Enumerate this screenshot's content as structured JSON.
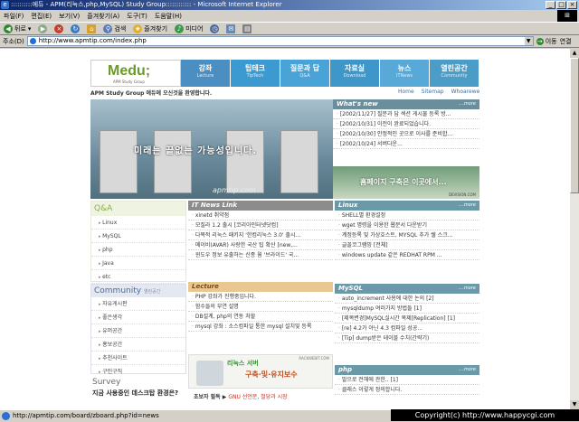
{
  "window": {
    "title": "::::::::::에듀 - APM(리눅스,php,MySQL) Study Group:::::::::::: - Microsoft Internet Explorer",
    "minimize": "_",
    "maximize": "□",
    "close": "×"
  },
  "menu": [
    "파일(F)",
    "편집(E)",
    "보기(V)",
    "즐겨찾기(A)",
    "도구(T)",
    "도움말(H)"
  ],
  "toolbar": {
    "back": "뒤로",
    "search": "검색",
    "favorites": "즐겨찾기",
    "media": "미디어"
  },
  "address": {
    "label": "주소(D)",
    "url": "http://www.apmtip.com/index.php",
    "go": "이동",
    "links": "연결"
  },
  "site": {
    "logo": "Medu;",
    "logo_sub": "APM Study Group",
    "nav": [
      {
        "ko": "강좌",
        "en": "Lecture",
        "color": "#4a8ec2"
      },
      {
        "ko": "팁테크",
        "en": "TipTech",
        "color": "#3d9ad0"
      },
      {
        "ko": "질문과 답",
        "en": "Q&A",
        "color": "#4aa3d6"
      },
      {
        "ko": "자료실",
        "en": "Download",
        "color": "#3e96c9"
      },
      {
        "ko": "뉴스",
        "en": "ITNews",
        "color": "#58a8d8"
      },
      {
        "ko": "열린공간",
        "en": "Community",
        "color": "#4b9cc6"
      }
    ],
    "welcome": "APM Study Group 에듀에 오신것을 환영합니다.",
    "top_links": [
      "Home",
      "Sitemap",
      "Whoarewe"
    ],
    "hero_slogan": "미래는 끝없는 가능성입니다.",
    "hero_watermark": "apmtip.com",
    "more": "....more",
    "whats_new": {
      "title": "What's new",
      "items": [
        "[2002/11/27] 질문과 답 섹션 게시물 등록 방...",
        "[2002/10/31] 이전이 완료되었습니다.",
        "[2002/10/30] 안정적인 곳으로 이사를 준비합...",
        "[2002/10/24] 서버다운..."
      ]
    },
    "banner": {
      "text": "홈페이지 구축은 이곳에서...",
      "site": "DEVISION.COM"
    },
    "qa": {
      "title": "Q&A",
      "items": [
        "Linux",
        "MySQL",
        "php",
        "Java",
        "etc"
      ]
    },
    "community": {
      "title": "Community",
      "sub": "열린공간",
      "items": [
        "자유게시판",
        "좋은생각",
        "유머공간",
        "홍보공간",
        "추천사이트",
        "구인구직"
      ]
    },
    "survey": {
      "title": "Survey",
      "question": "지금 사용중인 데스크탑 환경은?"
    },
    "itnews": {
      "title": "IT News Link",
      "items": [
        "xinetd 취약점",
        "모질라 1.2 출시 [코리아인터넷닷컴]",
        "다목적 리눅스 패키지 '한컴리눅스 3.0' 출시...",
        "메이비(AVAR) 사랑한 국산 팁 확산 [new,...",
        "윈도우 정보 유출하는 신종 웜 '브라이드' 국..."
      ]
    },
    "linux": {
      "title": "Linux",
      "items": [
        "SHELL별 환경설정",
        "wget 명령을 이용한 웹문서 다운받기",
        "계정등록 및 가상호스트, MYSQL 추가 쉘 스크...",
        "글꼴코그램밍 [전체]",
        "windows update 같은 REDHAT RPM ..."
      ]
    },
    "lecture": {
      "title": "Lecture",
      "items": [
        "PHP 강좌가 진행중입니다.",
        "함수들의 부연 설명",
        "DB설계, php의 연동 처할",
        "mysql 강좌 : 소스컴파일 통한 mysql 설치및 등록"
      ]
    },
    "linux_banner": {
      "line1": "리눅스 서버",
      "line2": "구축·및·유지보수",
      "site": "RACKWEBIT.COM"
    },
    "beginner": {
      "label": "초보자 필독 ▶",
      "text": "GNU 선언문, 철당과 시장"
    },
    "mysql": {
      "title": "MySQL",
      "items": [
        "auto_increment 사용에 대한 논의 [2]",
        "mysqldump 여러가지 방법들 [1]",
        "[제목변경]MySQL실시간 복제[Replication] [1]",
        "[re] 4.2가 아닌 4.3 컴파일 성공...",
        "[Tip] dump받은 테이블 수치(간략기)"
      ]
    },
    "php": {
      "title": "php",
      "items": [
        "말으로 전해에 관한.. [1]",
        "클래스 이렇게 정의합니다."
      ]
    }
  },
  "status": {
    "text": "http://apmtip.com/board/zboard.php?id=news",
    "copyright": "Copyright(c) http://www.happycgi.com"
  }
}
